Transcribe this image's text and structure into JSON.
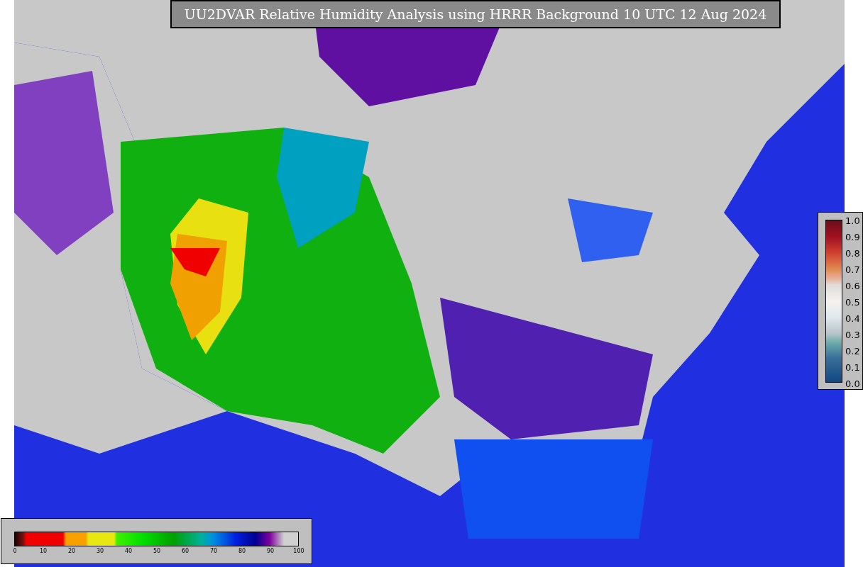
{
  "title": "UU2DVAR Relative Humidity Analysis using HRRR Background 10 UTC 12 Aug 2024",
  "humidity_colorbar": {
    "ticks": [
      "0",
      "10",
      "20",
      "30",
      "40",
      "50",
      "60",
      "70",
      "80",
      "90",
      "100"
    ]
  },
  "fraction_colorbar": {
    "ticks": [
      "1.0",
      "0.9",
      "0.8",
      "0.7",
      "0.6",
      "0.5",
      "0.4",
      "0.3",
      "0.2",
      "0.1",
      "0.0"
    ]
  }
}
